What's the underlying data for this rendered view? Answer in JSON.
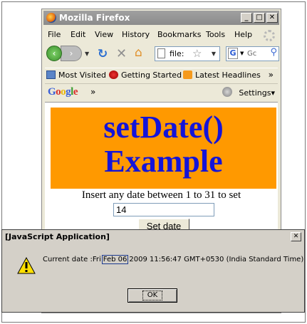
{
  "browser": {
    "window_title": "Mozilla Firefox",
    "menu": [
      "File",
      "Edit",
      "View",
      "History",
      "Bookmarks",
      "Tools",
      "Help"
    ],
    "url": "file:",
    "search_placeholder": "Gc",
    "bookmarks": [
      "Most Visited",
      "Getting Started",
      "Latest Headlines"
    ],
    "google_toolbar": {
      "logo": "Google",
      "chevron": "»",
      "settings": "Settings"
    }
  },
  "page": {
    "heading": "setDate() Example",
    "instruction": "Insert any date between 1 to 31 to set",
    "date_input_value": "14",
    "button_label": "Set date"
  },
  "dialog": {
    "title": "[JavaScript Application]",
    "message_prefix": "Current date :Fri",
    "message_highlight": "Feb 06",
    "message_suffix": "2009 11:56:47 GMT+0530 (India Standard Time)",
    "ok_label": "OK"
  },
  "colors": {
    "banner_bg": "#ff9900",
    "heading_text": "#1414d9",
    "titlebar_inactive": "#8c8c8c"
  }
}
